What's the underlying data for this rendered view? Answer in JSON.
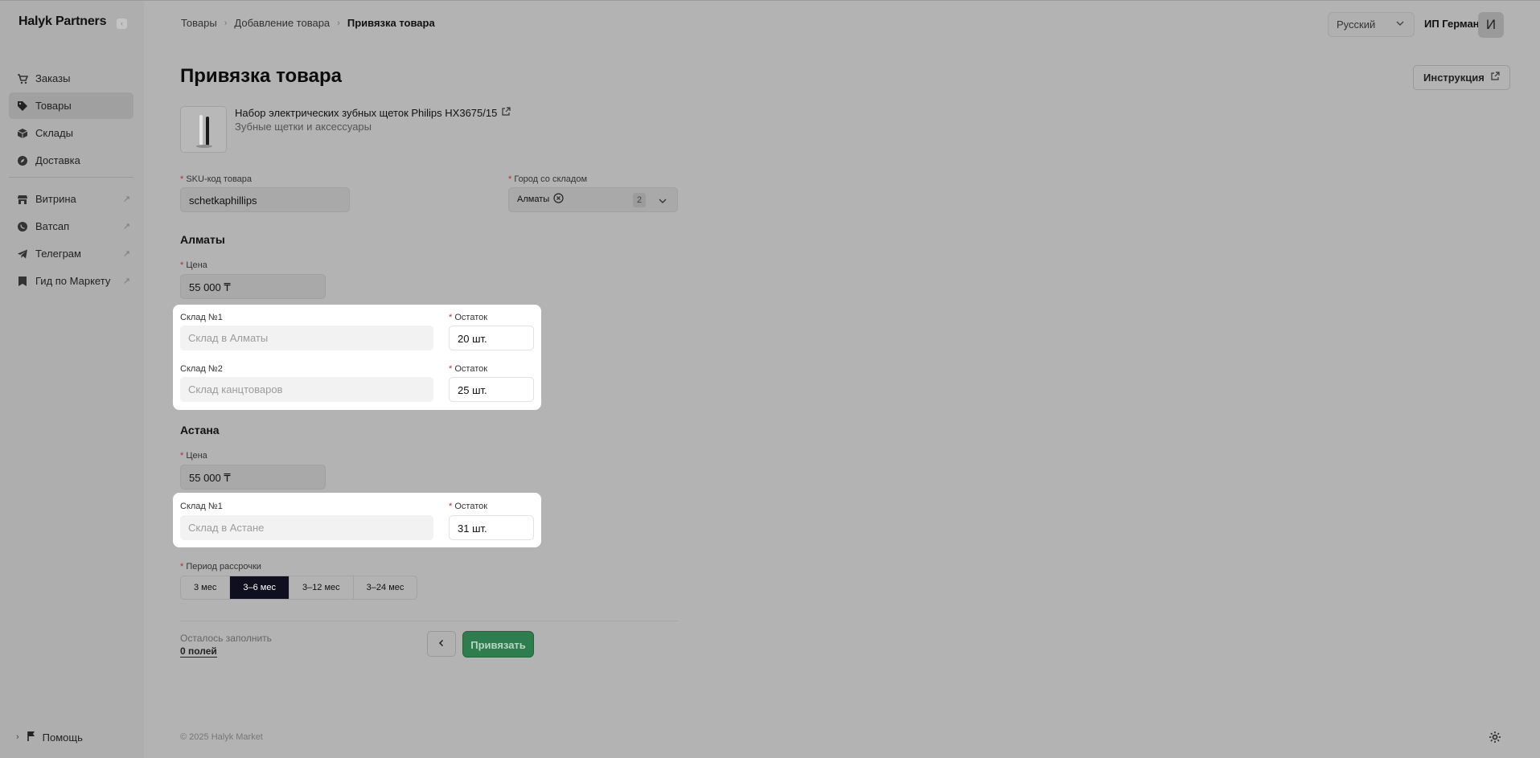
{
  "sidebar": {
    "brand": "Halyk Partners",
    "collapse_icon": "collapse-icon",
    "main_items": [
      {
        "label": "Заказы",
        "icon": "cart-icon",
        "active": false
      },
      {
        "label": "Товары",
        "icon": "tag-icon",
        "active": true
      },
      {
        "label": "Склады",
        "icon": "box-icon",
        "active": false
      },
      {
        "label": "Доставка",
        "icon": "compass-icon",
        "active": false
      }
    ],
    "external_items": [
      {
        "label": "Витрина",
        "icon": "store-icon"
      },
      {
        "label": "Ватсап",
        "icon": "whatsapp-icon"
      },
      {
        "label": "Телеграм",
        "icon": "telegram-icon"
      },
      {
        "label": "Гид по Маркету",
        "icon": "bookmark-icon"
      }
    ],
    "help_label": "Помощь"
  },
  "breadcrumb": [
    "Товары",
    "Добавление товара",
    "Привязка товара"
  ],
  "header": {
    "language": "Русский",
    "user_name": "ИП Герман",
    "avatar_letter": "И"
  },
  "page": {
    "title": "Привязка товара",
    "instructions_button": "Инструкция"
  },
  "product": {
    "name": "Набор электрических зубных щеток Philips HX3675/15",
    "category": "Зубные щетки и аксессуары"
  },
  "form": {
    "sku_label": "SKU-код товара",
    "sku_value": "schetkaphillips",
    "city_label": "Город со складом",
    "city_chip": "Алматы",
    "city_count": "2",
    "price_label": "Цена",
    "stock_label": "Остаток",
    "cities": [
      {
        "name": "Алматы",
        "price": "55 000 ₸",
        "warehouses": [
          {
            "label": "Склад №1",
            "placeholder": "Склад в Алматы",
            "stock": "20 шт."
          },
          {
            "label": "Склад №2",
            "placeholder": "Склад канцтоваров",
            "stock": "25 шт."
          }
        ]
      },
      {
        "name": "Астана",
        "price": "55 000 ₸",
        "warehouses": [
          {
            "label": "Склад №1",
            "placeholder": "Склад в Астане",
            "stock": "31 шт."
          }
        ]
      }
    ],
    "installment_label": "Период рассрочки",
    "installment_options": [
      "3 мес",
      "3–6 мес",
      "3–12 мес",
      "3–24 мес"
    ],
    "installment_selected": "3–6 мес",
    "remaining_label": "Осталось заполнить",
    "remaining_value": "0 полей",
    "back_icon": "chevron-left-icon",
    "submit_label": "Привязать"
  },
  "footer": {
    "copyright": "© 2025 Halyk Market"
  },
  "colors": {
    "accent_green": "#2e7d4f",
    "selected_segment": "#0f0f1f",
    "required": "#b03030"
  }
}
